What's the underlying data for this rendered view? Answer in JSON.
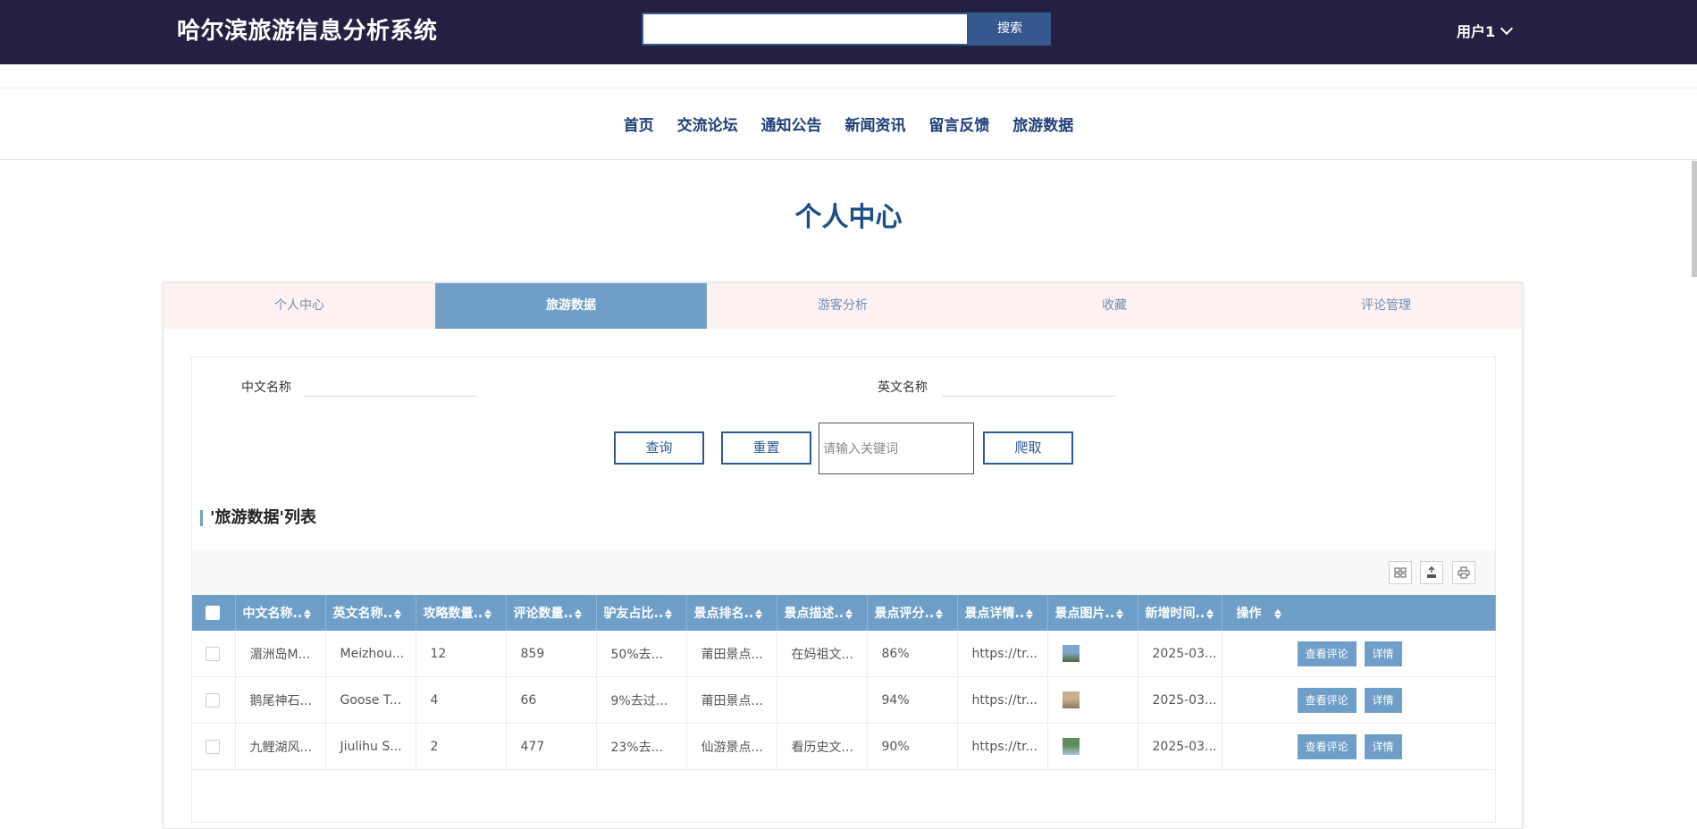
{
  "header": {
    "site_title": "哈尔滨旅游信息分析系统",
    "search_value": "",
    "search_button": "搜索",
    "user_label": "用户1"
  },
  "nav": {
    "items": [
      "首页",
      "交流论坛",
      "通知公告",
      "新闻资讯",
      "留言反馈",
      "旅游数据"
    ]
  },
  "page_title": "个人中心",
  "tabs": [
    "个人中心",
    "旅游数据",
    "游客分析",
    "收藏",
    "评论管理"
  ],
  "active_tab": "旅游数据",
  "filters": {
    "cn_name_label": "中文名称",
    "cn_name_value": "",
    "en_name_label": "英文名称",
    "en_name_value": "",
    "query_button": "查询",
    "reset_button": "重置",
    "keyword_placeholder": "请输入关键词",
    "crawl_button": "爬取"
  },
  "list_title": "'旅游数据'列表",
  "toolbar_icons": [
    "columns-icon",
    "export-icon",
    "print-icon"
  ],
  "table": {
    "columns": [
      "中文名称..",
      "英文名称..",
      "攻略数量..",
      "评论数量..",
      "驴友占比..",
      "景点排名..",
      "景点描述..",
      "景点评分..",
      "景点详情..",
      "景点图片..",
      "新增时间..",
      "操作"
    ],
    "rows": [
      {
        "cn_name": "湄洲岛M...",
        "en_name": "Meizhou...",
        "guides": "12",
        "comments": "859",
        "ratio": "50%去...",
        "rank": "莆田景点...",
        "desc": "在妈祖文...",
        "score": "86%",
        "detail": "https://tr...",
        "time": "2025-03...",
        "thumb_colors": [
          "#7fa6c9",
          "#4e6a3a"
        ]
      },
      {
        "cn_name": "鹅尾神石...",
        "en_name": "Goose T...",
        "guides": "4",
        "comments": "66",
        "ratio": "9%去过...",
        "rank": "莆田景点...",
        "desc": "",
        "score": "94%",
        "detail": "https://tr...",
        "time": "2025-03...",
        "thumb_colors": [
          "#c8b08a",
          "#8a7860"
        ]
      },
      {
        "cn_name": "九鲤湖风...",
        "en_name": "Jiulihu S...",
        "guides": "2",
        "comments": "477",
        "ratio": "23%去...",
        "rank": "仙游景点...",
        "desc": "看历史文...",
        "score": "90%",
        "detail": "https://tr...",
        "time": "2025-03...",
        "thumb_colors": [
          "#5f8c5a",
          "#a9c3d8"
        ]
      }
    ],
    "view_comments_button": "查看评论",
    "detail_button": "详情"
  }
}
